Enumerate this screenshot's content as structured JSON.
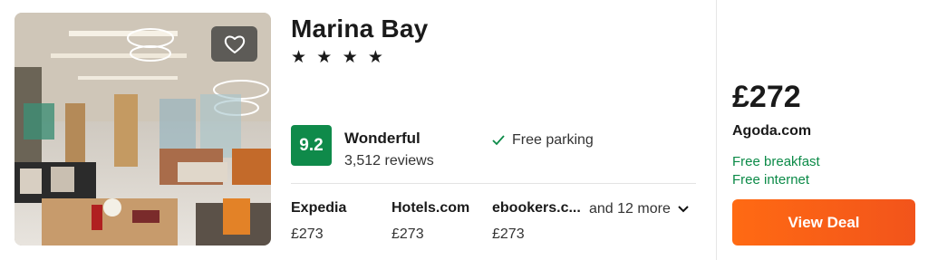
{
  "hotel": {
    "name": "Marina Bay",
    "stars": "★ ★ ★ ★"
  },
  "rating": {
    "score": "9.2",
    "label": "Wonderful",
    "reviews": "3,512 reviews"
  },
  "amenities": [
    "Free parking"
  ],
  "providers": [
    {
      "name": "Expedia",
      "price": "£273"
    },
    {
      "name": "Hotels.com",
      "price": "£273"
    },
    {
      "name": "ebookers.c...",
      "price": "£273"
    }
  ],
  "more_link": "and 12 more",
  "best_offer": {
    "price": "£272",
    "site": "Agoda.com",
    "perks": [
      "Free breakfast",
      "Free internet"
    ],
    "button": "View Deal"
  },
  "icons": {
    "favorite": "heart-outline-icon",
    "amenity_check": "checkmark-icon",
    "expand": "chevron-down-icon"
  },
  "colors": {
    "score_badge": "#0f8a4a",
    "perk_text": "#0b8a47",
    "cta_button": "#ff6a13"
  }
}
